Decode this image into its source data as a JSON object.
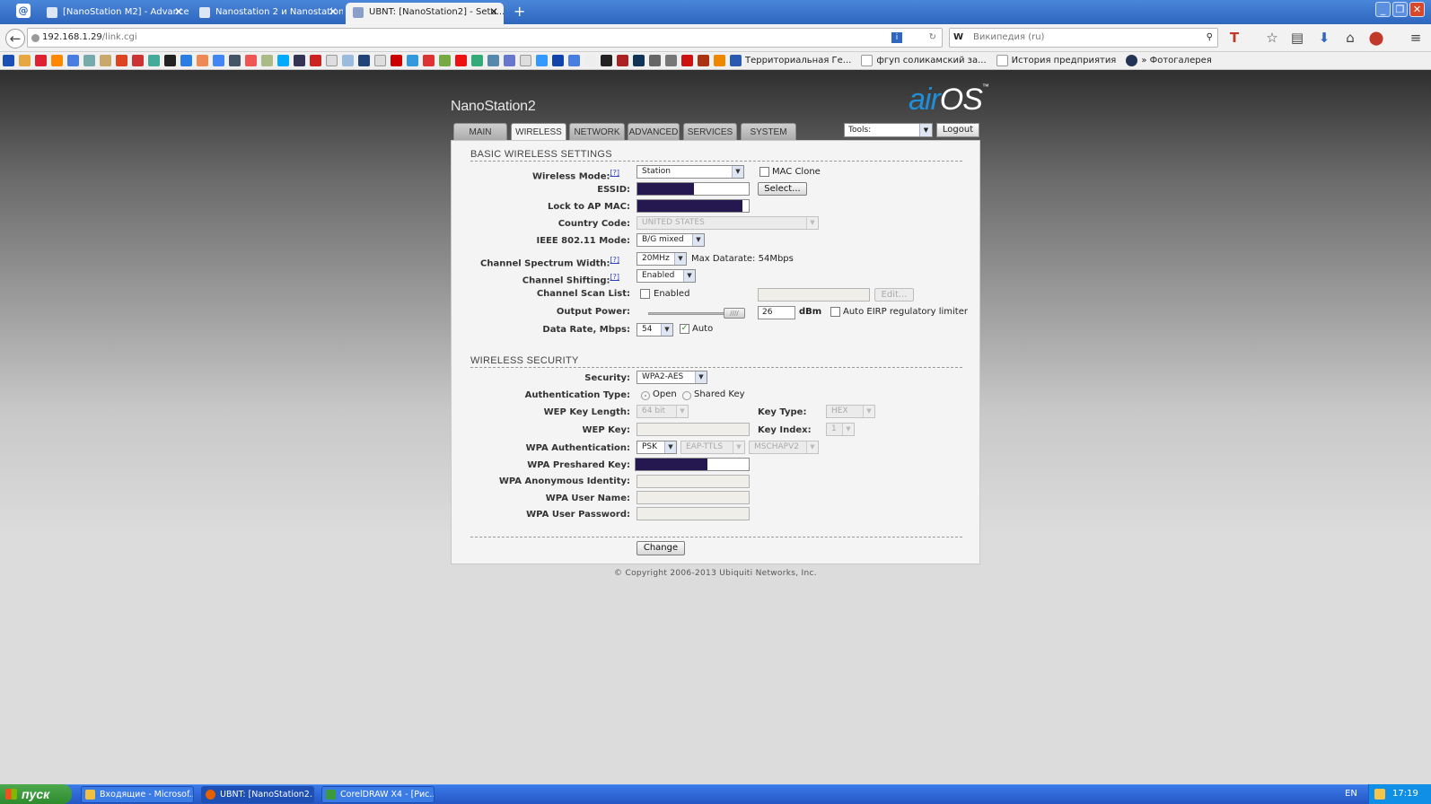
{
  "browser": {
    "tabs": [
      {
        "title": "[NanoStation M2] - Advanced"
      },
      {
        "title": "Nanostation 2 и Nanostation ..."
      },
      {
        "title": "UBNT: [NanoStation2] - Setu..."
      }
    ],
    "new_tab": "+",
    "url_host": "192.168.1.29",
    "url_path": "/link.cgi",
    "search_engine": "W",
    "search_placeholder": "Википедия (ru)",
    "bookmarks": [
      "Территориальная Ге...",
      "фгуп соликамский за...",
      "История предприятия",
      "» Фотогалерея"
    ]
  },
  "header": {
    "device_name": "NanoStation2",
    "logo_air": "air",
    "logo_os": "OS",
    "logo_tm": "™"
  },
  "menu": {
    "tabs": [
      "MAIN",
      "WIRELESS",
      "NETWORK",
      "ADVANCED",
      "SERVICES",
      "SYSTEM"
    ],
    "active": "WIRELESS",
    "tools": "Tools:",
    "logout": "Logout"
  },
  "basic": {
    "heading": "BASIC WIRELESS SETTINGS",
    "wireless_mode_label": "Wireless Mode:",
    "wireless_mode": "Station",
    "mac_clone": "MAC Clone",
    "essid_label": "ESSID:",
    "select_btn": "Select...",
    "lock_ap_label": "Lock to AP MAC:",
    "country_label": "Country Code:",
    "country": "UNITED STATES",
    "ieee_label": "IEEE 802.11 Mode:",
    "ieee": "B/G mixed",
    "csw_label": "Channel Spectrum Width:",
    "csw": "20MHz",
    "max_datarate": "Max Datarate: 54Mbps",
    "shift_label": "Channel Shifting:",
    "shift": "Enabled",
    "scan_label": "Channel Scan List:",
    "scan_enabled": "Enabled",
    "edit_btn": "Edit...",
    "power_label": "Output Power:",
    "power_value": "26",
    "power_unit": "dBm",
    "power_level": 1.0,
    "eirp": "Auto EIRP regulatory limiter",
    "rate_label": "Data Rate, Mbps:",
    "rate": "54",
    "auto": "Auto",
    "help": "[?]"
  },
  "security": {
    "heading": "WIRELESS SECURITY",
    "security_label": "Security:",
    "security": "WPA2-AES",
    "auth_type_label": "Authentication Type:",
    "open": "Open",
    "shared": "Shared Key",
    "wep_len_label": "WEP Key Length:",
    "wep_len": "64 bit",
    "key_type_label": "Key Type:",
    "key_type": "HEX",
    "wep_key_label": "WEP Key:",
    "key_index_label": "Key Index:",
    "key_index": "1",
    "wpa_auth_label": "WPA Authentication:",
    "wpa_auth": "PSK",
    "eap": "EAP-TTLS",
    "mschap": "MSCHAPV2",
    "psk_label": "WPA Preshared Key:",
    "anon_label": "WPA Anonymous Identity:",
    "user_label": "WPA User Name:",
    "pass_label": "WPA User Password:",
    "change_btn": "Change"
  },
  "footer": {
    "copyright": "© Copyright 2006-2013 Ubiquiti Networks, Inc."
  },
  "taskbar": {
    "start": "пуск",
    "tasks": [
      "Входящие - Microsof...",
      "UBNT: [NanoStation2...",
      "CorelDRAW X4 - [Рис..."
    ],
    "lang": "EN",
    "clock": "17:19"
  }
}
